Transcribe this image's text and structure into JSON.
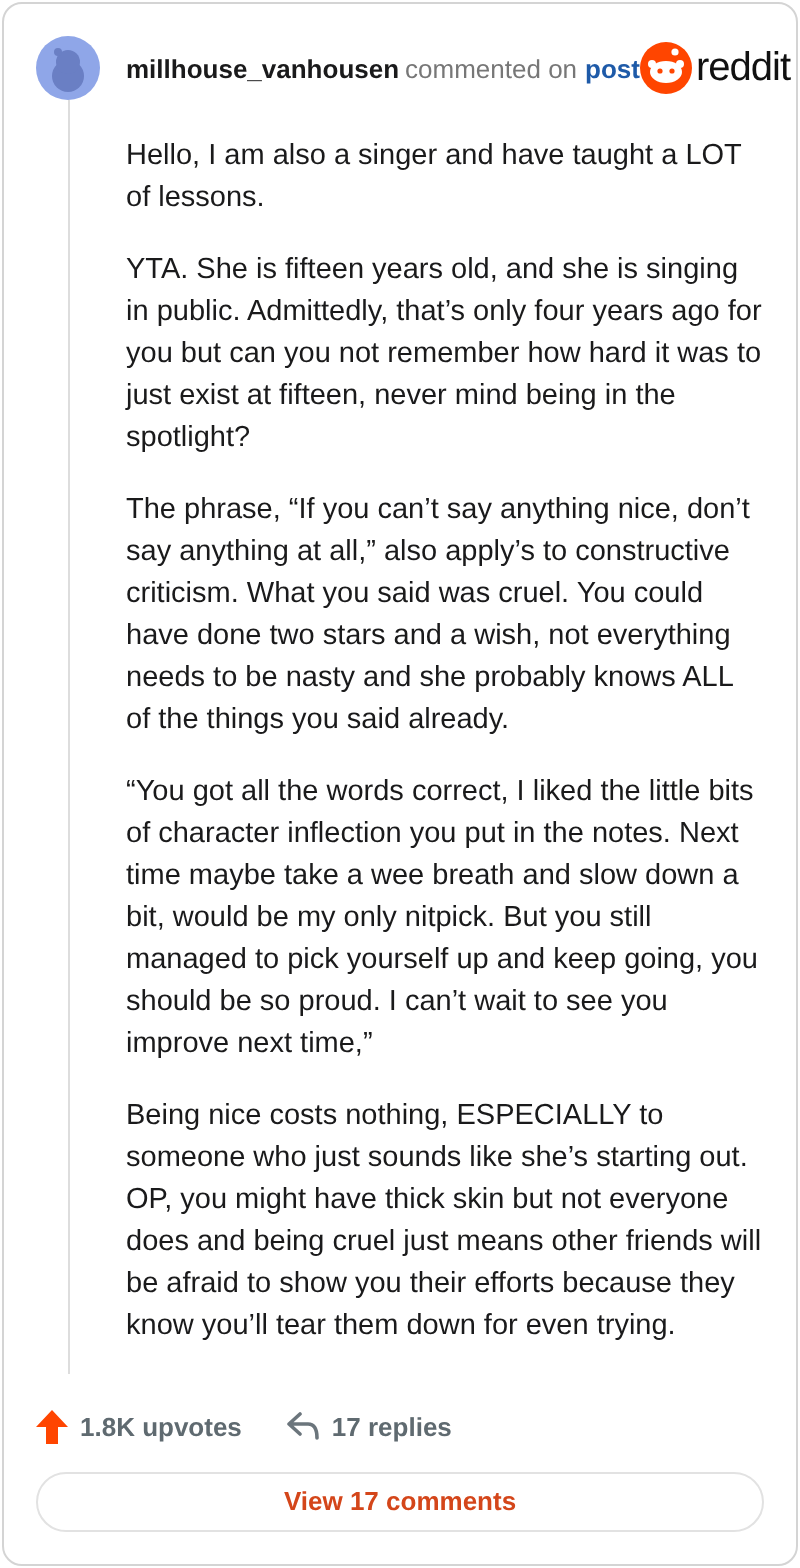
{
  "header": {
    "username": "millhouse_vanhousen",
    "action": "commented on",
    "link": "post",
    "brand": "reddit"
  },
  "paragraphs": [
    "Hello, I am also a singer and have taught a LOT of lessons.",
    "YTA. She is fifteen years old, and she is singing in public. Admittedly, that’s only four years ago for you but can you not remember how hard it was to just exist at fifteen, never mind being in the spotlight?",
    "The phrase, “If you can’t say anything nice, don’t say anything at all,” also apply’s to constructive criticism. What you said was cruel. You could have done two stars and a wish, not everything needs to be nasty and she probably knows ALL of the things you said already.",
    "“You got all the words correct, I liked the little bits of character inflection you put in the notes. Next time maybe take a wee breath and slow down a bit, would be my only nitpick. But you still managed to pick yourself up and keep going, you should be so proud. I can’t wait to see you improve next time,”",
    "Being nice costs nothing, ESPECIALLY to someone who just sounds like she’s starting out. OP, you might have thick skin but not everyone does and being cruel just means other friends will be afraid to show you their efforts because they know you’ll tear them down for even trying."
  ],
  "footer": {
    "upvotes": "1.8K upvotes",
    "replies": "17 replies",
    "button": "View 17 comments"
  }
}
